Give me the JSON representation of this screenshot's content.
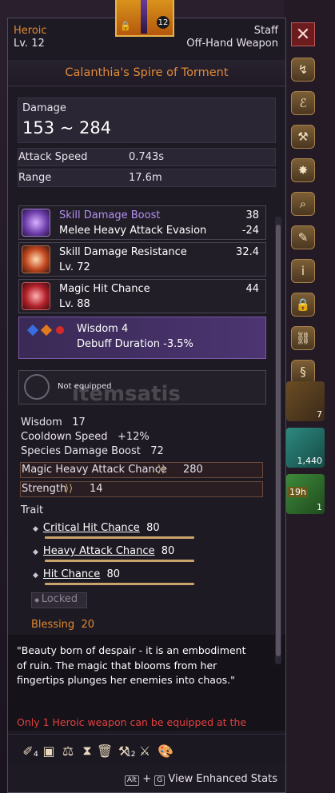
{
  "header": {
    "grade": "Heroic",
    "level": "Lv. 12",
    "weapon_type": "Staff",
    "slot": "Off-Hand Weapon",
    "item_icon_level": "12"
  },
  "item_name": "Calanthia's Spire of Torment",
  "damage": {
    "label": "Damage",
    "value": "153 ~ 284"
  },
  "attack_speed": {
    "label": "Attack Speed",
    "value": "0.743s"
  },
  "range": {
    "label": "Range",
    "value": "17.6m"
  },
  "engravings": [
    {
      "line1": "Skill Damage Boost",
      "value1": "38",
      "line2": "Melee Heavy Attack Evasion",
      "value2": "-24"
    },
    {
      "line1": "Skill Damage Resistance",
      "value1": "32.4",
      "line2": "Lv. 72",
      "value2": ""
    },
    {
      "line1": "Magic Hit Chance",
      "value1": "44",
      "line2": "Lv. 88",
      "value2": ""
    }
  ],
  "set_bonus": {
    "line1": "Wisdom 4",
    "line2": "Debuff Duration -3.5%"
  },
  "socket": {
    "label": "Not equipped"
  },
  "watermark": "itemsatis",
  "stats": [
    {
      "label": "Wisdom",
      "value": "17"
    },
    {
      "label": "Cooldown Speed",
      "value": "+12%"
    },
    {
      "label": "Species Damage Boost",
      "value": "72"
    }
  ],
  "bonus_stats": [
    {
      "label": "Magic Heavy Attack Chance",
      "value": "280"
    },
    {
      "label": "Strength",
      "value": "14"
    }
  ],
  "trait": {
    "title": "Trait",
    "items": [
      {
        "label": "Critical Hit Chance",
        "value": "80"
      },
      {
        "label": "Heavy Attack Chance",
        "value": "80"
      },
      {
        "label": "Hit Chance",
        "value": "80"
      }
    ],
    "locked_label": "Locked"
  },
  "blessing": {
    "label": "Blessing",
    "value": "20"
  },
  "description": "\"Beauty born of despair - it is an embodiment of ruin. The magic that blooms from her fingertips plunges her enemies into chaos.\"",
  "warning": "Only 1 Heroic weapon can be equipped at the",
  "bottom_icons": {
    "count_a": "4",
    "count_b": "12"
  },
  "footer": {
    "alt_key": "Alt",
    "plus": "+",
    "g_key": "G",
    "label": "View Enhanced Stats"
  },
  "inventory": {
    "slot_counts": [
      "7",
      "1,440",
      "19h",
      "1"
    ]
  },
  "colors": {
    "heroic": "#e0892f",
    "title": "#e08a3a",
    "magic_purple": "#b290f0",
    "warning_red": "#e0413f",
    "gold_bar": "#c9a46a"
  }
}
